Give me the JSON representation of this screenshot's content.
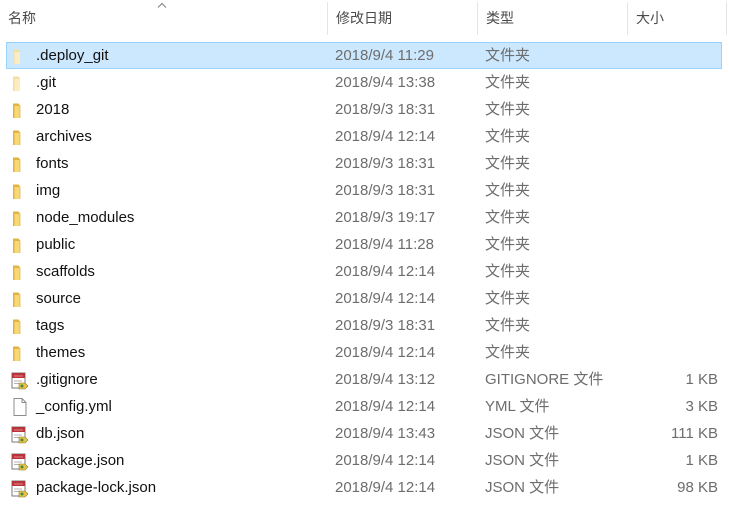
{
  "header": {
    "columns": [
      {
        "key": "name",
        "label": "名称"
      },
      {
        "key": "date",
        "label": "修改日期"
      },
      {
        "key": "type",
        "label": "类型"
      },
      {
        "key": "size",
        "label": "大小"
      }
    ],
    "sort_column": "name"
  },
  "files": [
    {
      "name": ".deploy_git",
      "date": "2018/9/4 11:29",
      "type": "文件夹",
      "size": "",
      "icon": "folder-light-icon",
      "selected": true
    },
    {
      "name": ".git",
      "date": "2018/9/4 13:38",
      "type": "文件夹",
      "size": "",
      "icon": "folder-light-icon",
      "selected": false
    },
    {
      "name": "2018",
      "date": "2018/9/3 18:31",
      "type": "文件夹",
      "size": "",
      "icon": "folder-icon",
      "selected": false
    },
    {
      "name": "archives",
      "date": "2018/9/4 12:14",
      "type": "文件夹",
      "size": "",
      "icon": "folder-icon",
      "selected": false
    },
    {
      "name": "fonts",
      "date": "2018/9/3 18:31",
      "type": "文件夹",
      "size": "",
      "icon": "folder-icon",
      "selected": false
    },
    {
      "name": "img",
      "date": "2018/9/3 18:31",
      "type": "文件夹",
      "size": "",
      "icon": "folder-icon",
      "selected": false
    },
    {
      "name": "node_modules",
      "date": "2018/9/3 19:17",
      "type": "文件夹",
      "size": "",
      "icon": "folder-icon",
      "selected": false
    },
    {
      "name": "public",
      "date": "2018/9/4 11:28",
      "type": "文件夹",
      "size": "",
      "icon": "folder-icon",
      "selected": false
    },
    {
      "name": "scaffolds",
      "date": "2018/9/4 12:14",
      "type": "文件夹",
      "size": "",
      "icon": "folder-icon",
      "selected": false
    },
    {
      "name": "source",
      "date": "2018/9/4 12:14",
      "type": "文件夹",
      "size": "",
      "icon": "folder-icon",
      "selected": false
    },
    {
      "name": "tags",
      "date": "2018/9/3 18:31",
      "type": "文件夹",
      "size": "",
      "icon": "folder-icon",
      "selected": false
    },
    {
      "name": "themes",
      "date": "2018/9/4 12:14",
      "type": "文件夹",
      "size": "",
      "icon": "folder-icon",
      "selected": false
    },
    {
      "name": ".gitignore",
      "date": "2018/9/4 13:12",
      "type": "GITIGNORE 文件",
      "size": "1 KB",
      "icon": "editor-file-icon",
      "selected": false
    },
    {
      "name": "_config.yml",
      "date": "2018/9/4 12:14",
      "type": "YML 文件",
      "size": "3 KB",
      "icon": "blank-file-icon",
      "selected": false
    },
    {
      "name": "db.json",
      "date": "2018/9/4 13:43",
      "type": "JSON 文件",
      "size": "111 KB",
      "icon": "editor-file-icon",
      "selected": false
    },
    {
      "name": "package.json",
      "date": "2018/9/4 12:14",
      "type": "JSON 文件",
      "size": "1 KB",
      "icon": "editor-file-icon",
      "selected": false
    },
    {
      "name": "package-lock.json",
      "date": "2018/9/4 12:14",
      "type": "JSON 文件",
      "size": "98 KB",
      "icon": "editor-file-icon",
      "selected": false
    }
  ],
  "colors": {
    "selection_fill": "#cce8ff",
    "selection_border": "#99d1ff",
    "folder": "#f8d775",
    "folder_dark": "#e2b33e"
  }
}
